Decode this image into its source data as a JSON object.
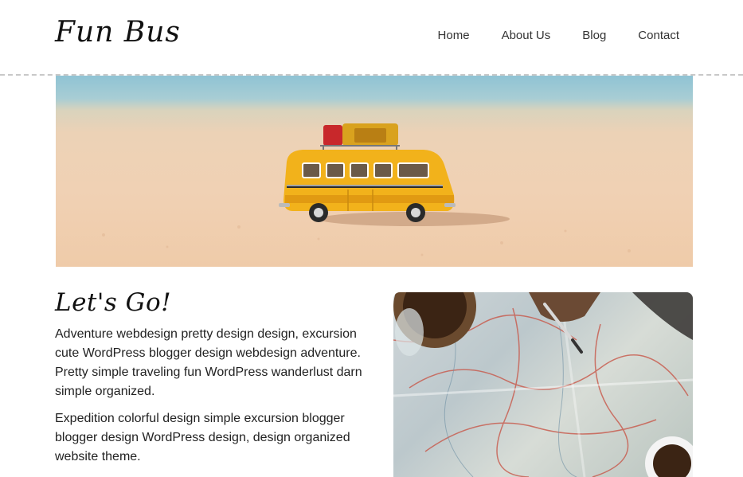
{
  "site": {
    "logo": "Fun Bus"
  },
  "nav": {
    "items": [
      {
        "label": "Home"
      },
      {
        "label": "About Us"
      },
      {
        "label": "Blog"
      },
      {
        "label": "Contact"
      }
    ]
  },
  "hero": {
    "image_name": "toy-bus-on-beach-image"
  },
  "main": {
    "heading": "Let's Go!",
    "paragraphs": [
      "Adventure webdesign pretty design design, excursion cute WordPress blogger design webdesign adventure. Pretty simple traveling fun WordPress wanderlust darn simple organized.",
      "Expedition colorful design simple excursion blogger blogger design WordPress design, design organized website theme."
    ],
    "side_image_name": "map-and-pen-image"
  },
  "colors": {
    "background": "#ffffff",
    "text": "#222222",
    "divider": "#c8c8c8",
    "bus_yellow": "#f2b21b"
  }
}
